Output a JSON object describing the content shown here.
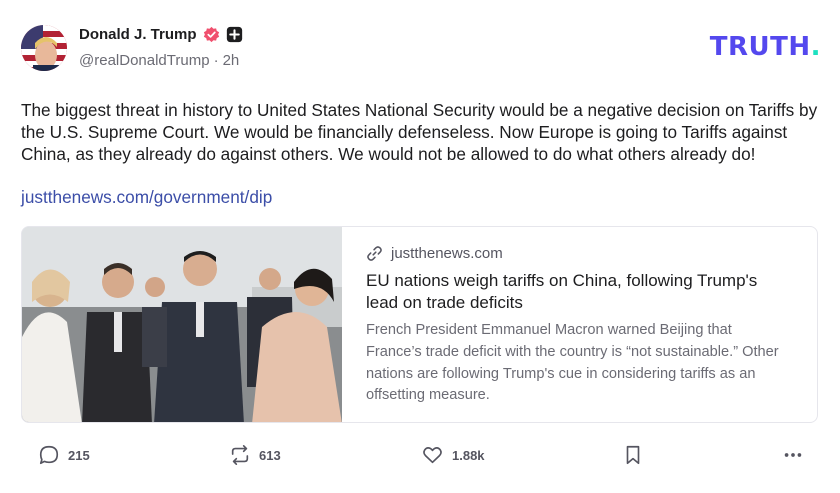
{
  "author": {
    "display_name": "Donald J. Trump",
    "handle": "@realDonaldTrump",
    "separator": "·",
    "time_ago": "2h",
    "verified_color": "#f0506e",
    "avatar_icon": "flag-portrait-avatar"
  },
  "brand": {
    "logo_text": "TRUTH",
    "logo_dot": ".",
    "logo_color": "#5448ee",
    "accent_color": "#1de1c0"
  },
  "post": {
    "text": "The biggest threat in history to United States National Security would be a negative decision on Tariffs by the U.S. Supreme Court. We would be financially defenseless. Now Europe is going to Tariffs against China, as they already do against others. We would not be allowed to do what others already do!",
    "link_text": "justthenews.com/government/dip"
  },
  "link_card": {
    "domain": "justthenews.com",
    "title": "EU nations weigh tariffs on China, following Trump's lead on trade deficits",
    "description": "French President Emmanuel Macron warned Beijing that France’s trade deficit with the country is “not sustainable.” Other nations are following Trump's cue in considering tariffs as an offsetting measure.",
    "image_icon": "news-photo"
  },
  "actions": {
    "replies": "215",
    "retruths": "613",
    "likes": "1.88k"
  }
}
